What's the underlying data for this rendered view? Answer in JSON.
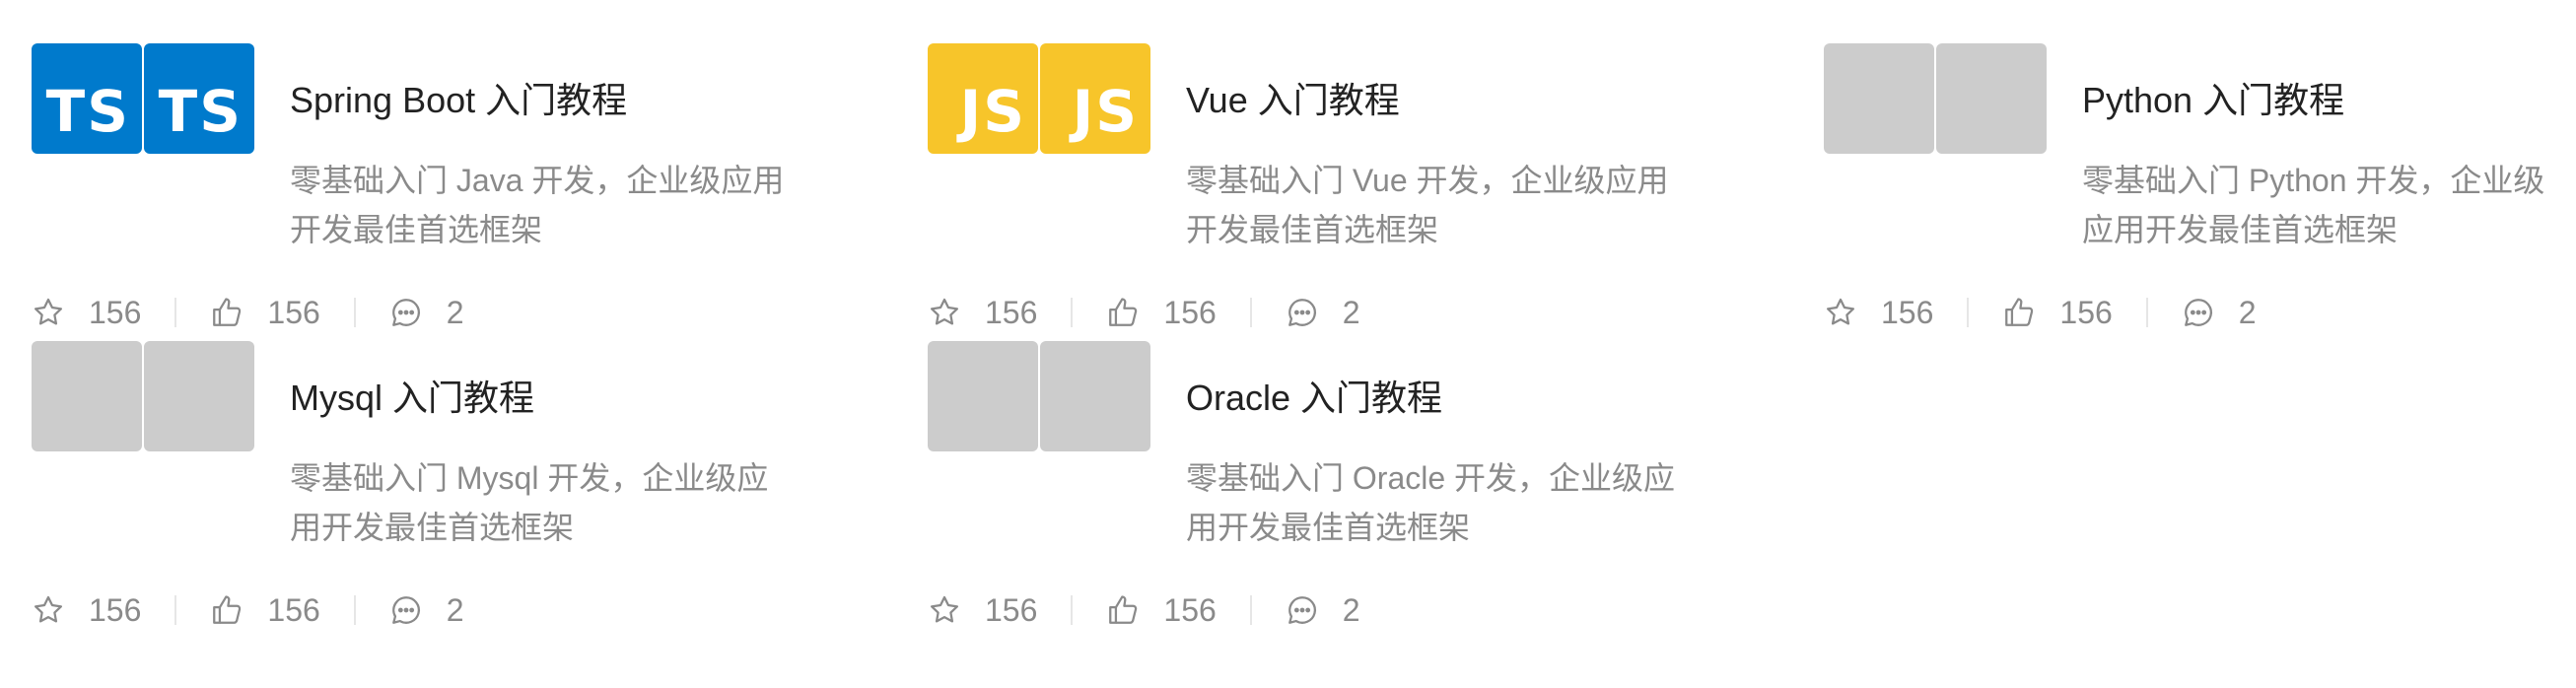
{
  "cards": [
    {
      "title": "Spring Boot 入门教程",
      "desc": "零基础入门 Java 开发，企业级应用开发最佳首选框架",
      "thumbs": [
        {
          "text": "TS",
          "style": "ts"
        },
        {
          "text": "TS",
          "style": "ts"
        }
      ],
      "stars": "156",
      "likes": "156",
      "comments": "2"
    },
    {
      "title": "Vue 入门教程",
      "desc": "零基础入门 Vue 开发，企业级应用开发最佳首选框架",
      "thumbs": [
        {
          "text": "JS",
          "style": "js"
        },
        {
          "text": "JS",
          "style": "js"
        }
      ],
      "stars": "156",
      "likes": "156",
      "comments": "2"
    },
    {
      "title": "Python 入门教程",
      "desc": "零基础入门 Python 开发，企业级应用开发最佳首选框架",
      "thumbs": [
        {
          "text": "",
          "style": "blank"
        },
        {
          "text": "",
          "style": "blank"
        }
      ],
      "stars": "156",
      "likes": "156",
      "comments": "2"
    },
    {
      "title": "Mysql 入门教程",
      "desc": "零基础入门 Mysql 开发，企业级应用开发最佳首选框架",
      "thumbs": [
        {
          "text": "",
          "style": "blank"
        },
        {
          "text": "",
          "style": "blank"
        }
      ],
      "stars": "156",
      "likes": "156",
      "comments": "2"
    },
    {
      "title": "Oracle 入门教程",
      "desc": "零基础入门 Oracle 开发，企业级应用开发最佳首选框架",
      "thumbs": [
        {
          "text": "",
          "style": "blank"
        },
        {
          "text": "",
          "style": "blank"
        }
      ],
      "stars": "156",
      "likes": "156",
      "comments": "2"
    }
  ],
  "colors": {
    "ts_blue": "#007acc",
    "js_yellow": "#f7c52a",
    "placeholder_gray": "#cccccc",
    "muted_text": "#8a8a8a"
  },
  "icons": {
    "stars": "star-icon",
    "likes": "thumbs-up-icon",
    "comments": "comment-icon"
  }
}
